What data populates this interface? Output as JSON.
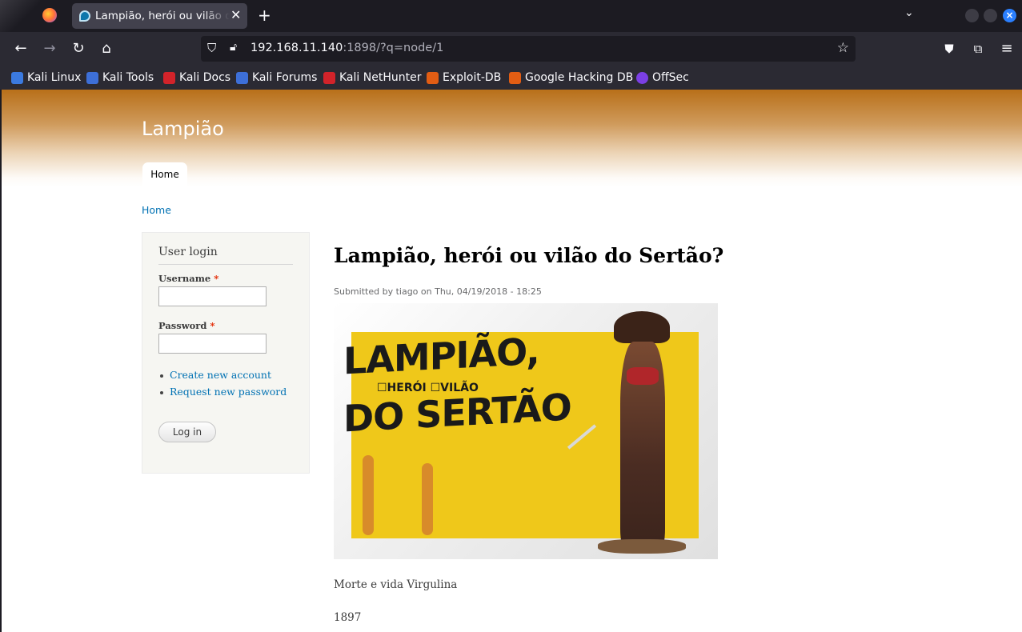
{
  "browser": {
    "tab_title": "Lampião, herói ou vilão do Sertão?",
    "url_host": "192.168.11.140",
    "url_rest": ":1898/?q=node/1",
    "bookmarks": [
      {
        "label": "Kali Linux",
        "color": "#3b7ae0"
      },
      {
        "label": "Kali Tools",
        "color": "#3d6fd8"
      },
      {
        "label": "Kali Docs",
        "color": "#d2232a"
      },
      {
        "label": "Kali Forums",
        "color": "#3d6fd8"
      },
      {
        "label": "Kali NetHunter",
        "color": "#d2232a"
      },
      {
        "label": "Exploit-DB",
        "color": "#e25d13"
      },
      {
        "label": "Google Hacking DB",
        "color": "#e25d13"
      },
      {
        "label": "OffSec",
        "color": "#7b3fe4"
      }
    ]
  },
  "site": {
    "name": "Lampião",
    "menu_home": "Home",
    "breadcrumb": "Home"
  },
  "login": {
    "title": "User login",
    "username_label": "Username",
    "password_label": "Password",
    "required_mark": "*",
    "links": [
      "Create new account",
      "Request new password"
    ],
    "button": "Log in"
  },
  "node": {
    "title": "Lampião, herói ou vilão do Sertão?",
    "submitted_prefix": "Submitted by ",
    "author": "tiago",
    "submitted_on": " on Thu, 04/19/2018 - 18:25",
    "image": {
      "line1": "LAMPIÃO,",
      "checkbox_text": "☐HERÓI  ☐VILÃO",
      "line2": "DO SERTÃO"
    },
    "paragraph1": "Morte e vida Virgulina",
    "paragraph2": "1897"
  }
}
